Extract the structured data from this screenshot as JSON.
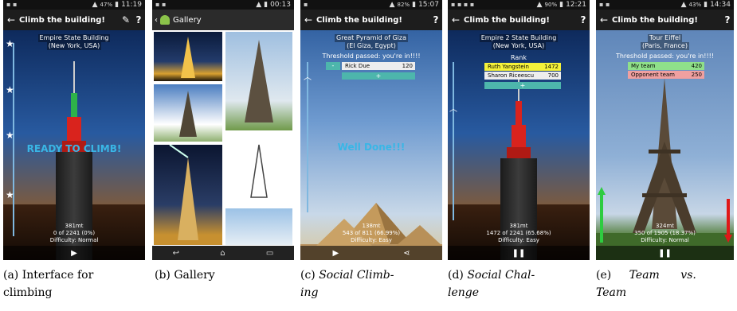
{
  "screens": {
    "interface": {
      "status_time": "11:19",
      "status_battery": "47%",
      "title": "Climb the building!",
      "back_icon": "back-arrow-icon",
      "edit_icon": "pencil-icon",
      "help_label": "?",
      "place_line1": "Empire State Building",
      "place_line2": "(New York, USA)",
      "message": "READY TO CLIMB!",
      "stat_height": "381mt",
      "stat_progress": "0 of 2241 (0%)",
      "stat_difficulty": "Difficulty: Normal",
      "play_icon": "play-icon"
    },
    "gallery": {
      "status_time": "00:13",
      "title": "Gallery",
      "app_icon": "android-icon"
    },
    "social_climbing": {
      "status_time": "15:07",
      "status_battery": "82%",
      "title": "Climb the building!",
      "help_label": "?",
      "place_line1": "Great Pyramid of Giza",
      "place_line2": "(El Giza, Egypt)",
      "threshold": "Threshold passed: you're in!!!!",
      "minus_label": "-",
      "player_name": "Rick Due",
      "player_score": "120",
      "plus_label": "+",
      "message": "Well Done!!!",
      "stat_height": "138mt",
      "stat_progress": "543 of 811 (66.99%)",
      "stat_difficulty": "Difficulty: Easy",
      "play_icon": "play-icon",
      "share_icon": "share-icon"
    },
    "social_challenge": {
      "status_time": "12:21",
      "status_battery": "90%",
      "title": "Climb the building!",
      "help_label": "?",
      "place_line1": "Empire 2 State Building",
      "place_line2": "(New York, USA)",
      "rank_label": "Rank",
      "ranking": [
        {
          "name": "Ruth Yangstein",
          "score": "1472",
          "color": "#f5f23a"
        },
        {
          "name": "Sharon Riceescu",
          "score": "700",
          "color": "#eeeeee"
        }
      ],
      "plus_label": "+",
      "stat_height": "381mt",
      "stat_progress": "1472 of 2241 (65.68%)",
      "stat_difficulty": "Difficulty: Easy",
      "pause_icon": "pause-icon"
    },
    "team": {
      "status_time": "14:34",
      "status_battery": "43%",
      "title": "Climb the building!",
      "help_label": "?",
      "place_line1": "Tour Eiffel",
      "place_line2": "(Paris, France)",
      "threshold": "Threshold passed: you're in!!!!",
      "teams": [
        {
          "name": "My team",
          "score": "420",
          "color": "#8fe08a"
        },
        {
          "name": "Opponent team",
          "score": "250",
          "color": "#f0a0a0"
        }
      ],
      "stat_height": "324mt",
      "stat_progress": "350 of 1905 (18.37%)",
      "stat_difficulty": "Difficulty: Normal",
      "pause_icon": "pause-icon"
    }
  },
  "captions": {
    "a_tag": "(a)",
    "a_text1": "Interface for",
    "a_text2": "climbing",
    "b_tag": "(b)",
    "b_text": "Gallery",
    "c_tag": "(c)",
    "c_text1": "Social Climb-",
    "c_text2": "ing",
    "d_tag": "(d)",
    "d_text1": "Social Chal-",
    "d_text2": "lenge",
    "e_tag": "(e)",
    "e_text1": "Team",
    "e_text1b": "vs.",
    "e_text2": "Team"
  }
}
